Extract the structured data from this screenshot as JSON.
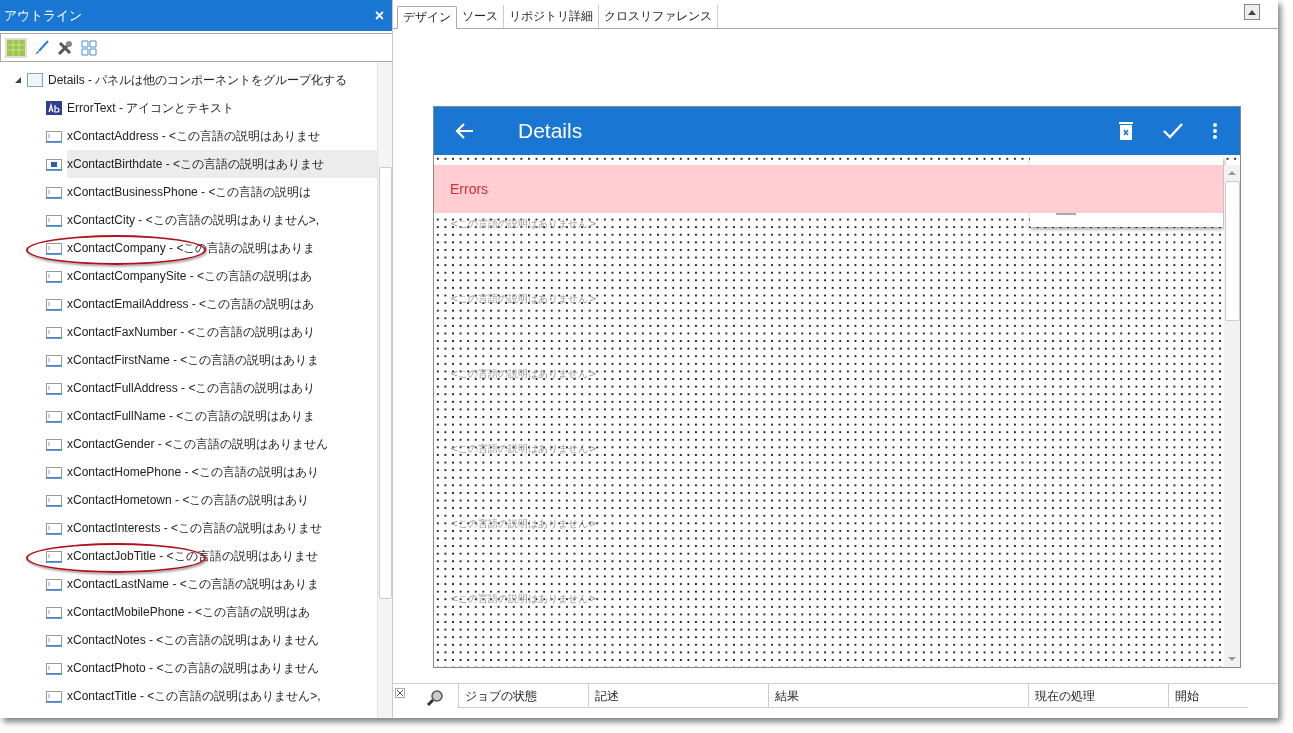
{
  "outline": {
    "title": "アウトライン",
    "close": "×",
    "tree": [
      {
        "label": "Details - パネルは他のコンポーネントをグループ化する",
        "kind": "panel",
        "expanded": true,
        "selected": false,
        "children": [
          {
            "label": "ErrorText - アイコンとテキスト",
            "kind": "text",
            "selected": false,
            "circled": false
          },
          {
            "label": "xContactAddress - <この言語の説明はありませ",
            "kind": "field",
            "selected": false,
            "circled": false
          },
          {
            "label": "xContactBirthdate - <この言語の説明はありませ",
            "kind": "date",
            "selected": true,
            "circled": false
          },
          {
            "label": "xContactBusinessPhone - <この言語の説明は",
            "kind": "field",
            "selected": false,
            "circled": false
          },
          {
            "label": "xContactCity - <この言語の説明はありません>,",
            "kind": "field",
            "selected": false,
            "circled": false
          },
          {
            "label": "xContactCompany - <この言語の説明はありま",
            "kind": "field",
            "selected": false,
            "circled": true
          },
          {
            "label": "xContactCompanySite - <この言語の説明はあ",
            "kind": "field",
            "selected": false,
            "circled": false
          },
          {
            "label": "xContactEmailAddress - <この言語の説明はあ",
            "kind": "field",
            "selected": false,
            "circled": false
          },
          {
            "label": "xContactFaxNumber - <この言語の説明はあり",
            "kind": "field",
            "selected": false,
            "circled": false
          },
          {
            "label": "xContactFirstName - <この言語の説明はありま",
            "kind": "field",
            "selected": false,
            "circled": false
          },
          {
            "label": "xContactFullAddress - <この言語の説明はあり",
            "kind": "field",
            "selected": false,
            "circled": false
          },
          {
            "label": "xContactFullName - <この言語の説明はありま",
            "kind": "field",
            "selected": false,
            "circled": false
          },
          {
            "label": "xContactGender - <この言語の説明はありません",
            "kind": "field",
            "selected": false,
            "circled": false
          },
          {
            "label": "xContactHomePhone - <この言語の説明はあり",
            "kind": "field",
            "selected": false,
            "circled": false
          },
          {
            "label": "xContactHometown - <この言語の説明はあり",
            "kind": "field",
            "selected": false,
            "circled": false
          },
          {
            "label": "xContactInterests - <この言語の説明はありませ",
            "kind": "field",
            "selected": false,
            "circled": false
          },
          {
            "label": "xContactJobTitle - <この言語の説明はありませ",
            "kind": "field",
            "selected": false,
            "circled": true
          },
          {
            "label": "xContactLastName - <この言語の説明はありま",
            "kind": "field",
            "selected": false,
            "circled": false
          },
          {
            "label": "xContactMobilePhone - <この言語の説明はあ",
            "kind": "field",
            "selected": false,
            "circled": false
          },
          {
            "label": "xContactNotes - <この言語の説明はありません",
            "kind": "field",
            "selected": false,
            "circled": false
          },
          {
            "label": "xContactPhoto - <この言語の説明はありません",
            "kind": "field",
            "selected": false,
            "circled": false
          },
          {
            "label": "xContactTitle - <この言語の説明はありません>,",
            "kind": "field",
            "selected": false,
            "circled": false
          }
        ]
      }
    ]
  },
  "tabs": [
    {
      "label": "デザイン",
      "selected": true
    },
    {
      "label": "ソース",
      "selected": false
    },
    {
      "label": "リポジトリ詳細",
      "selected": false
    },
    {
      "label": "クロスリファレンス",
      "selected": false
    }
  ],
  "design": {
    "title": "Details",
    "error": "Errors",
    "placeholders": [
      "<この言語の説明はありません>",
      "<この言語の説明はありません>",
      "<この言語の説明はありません>",
      "<この言語の説明はありません>",
      "<この言語の説明はありません>",
      "<この言語の説明はありません>"
    ]
  },
  "jobs": {
    "columns": [
      "ジョブの状態",
      "記述",
      "結果",
      "現在の処理",
      "開始"
    ]
  }
}
